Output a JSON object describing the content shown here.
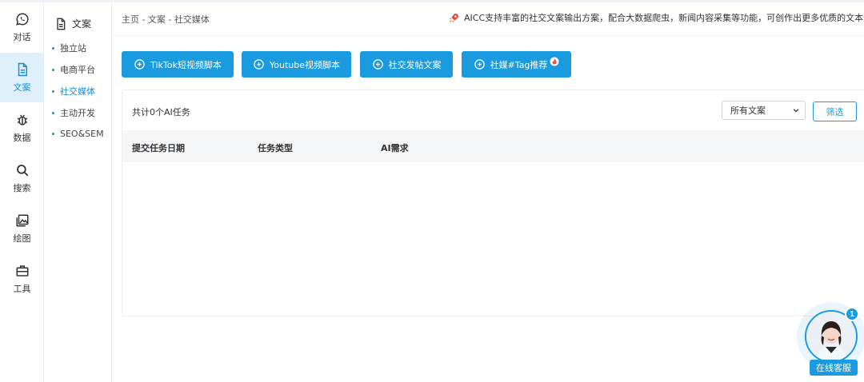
{
  "rail": {
    "items": [
      {
        "label": "对话",
        "icon": "whatsapp-chat-icon"
      },
      {
        "label": "文案",
        "icon": "document-icon",
        "active": true
      },
      {
        "label": "数据",
        "icon": "bug-icon"
      },
      {
        "label": "搜索",
        "icon": "search-icon"
      },
      {
        "label": "绘图",
        "icon": "image-icon"
      },
      {
        "label": "工具",
        "icon": "toolbox-icon"
      }
    ]
  },
  "subnav": {
    "title": "文案",
    "items": [
      {
        "label": "独立站"
      },
      {
        "label": "电商平台"
      },
      {
        "label": "社交媒体",
        "active": true
      },
      {
        "label": "主动开发"
      },
      {
        "label": "SEO&SEM"
      }
    ]
  },
  "header": {
    "breadcrumb": "主页 - 文案 - 社交媒体",
    "notice": "AICC支持丰富的社交文案输出方案，配合大数据爬虫，新闻内容采集等功能，可创作出更多优质的文本信息!"
  },
  "actions": [
    {
      "label": "TikTok短视频脚本"
    },
    {
      "label": "Youtube视频脚本"
    },
    {
      "label": "社交发帖文案"
    },
    {
      "label": "社媒#Tag推荐",
      "hot": true
    }
  ],
  "panel": {
    "task_count": "共计0个AI任务",
    "filter_selected": "所有文案",
    "filter_button": "筛选",
    "columns": [
      "提交任务日期",
      "任务类型",
      "AI需求"
    ]
  },
  "chat": {
    "badge": "1",
    "label": "在线客服"
  },
  "colors": {
    "accent": "#1a9be0",
    "active_bg": "#dff0fb",
    "table_head": "#f5f6f8"
  }
}
